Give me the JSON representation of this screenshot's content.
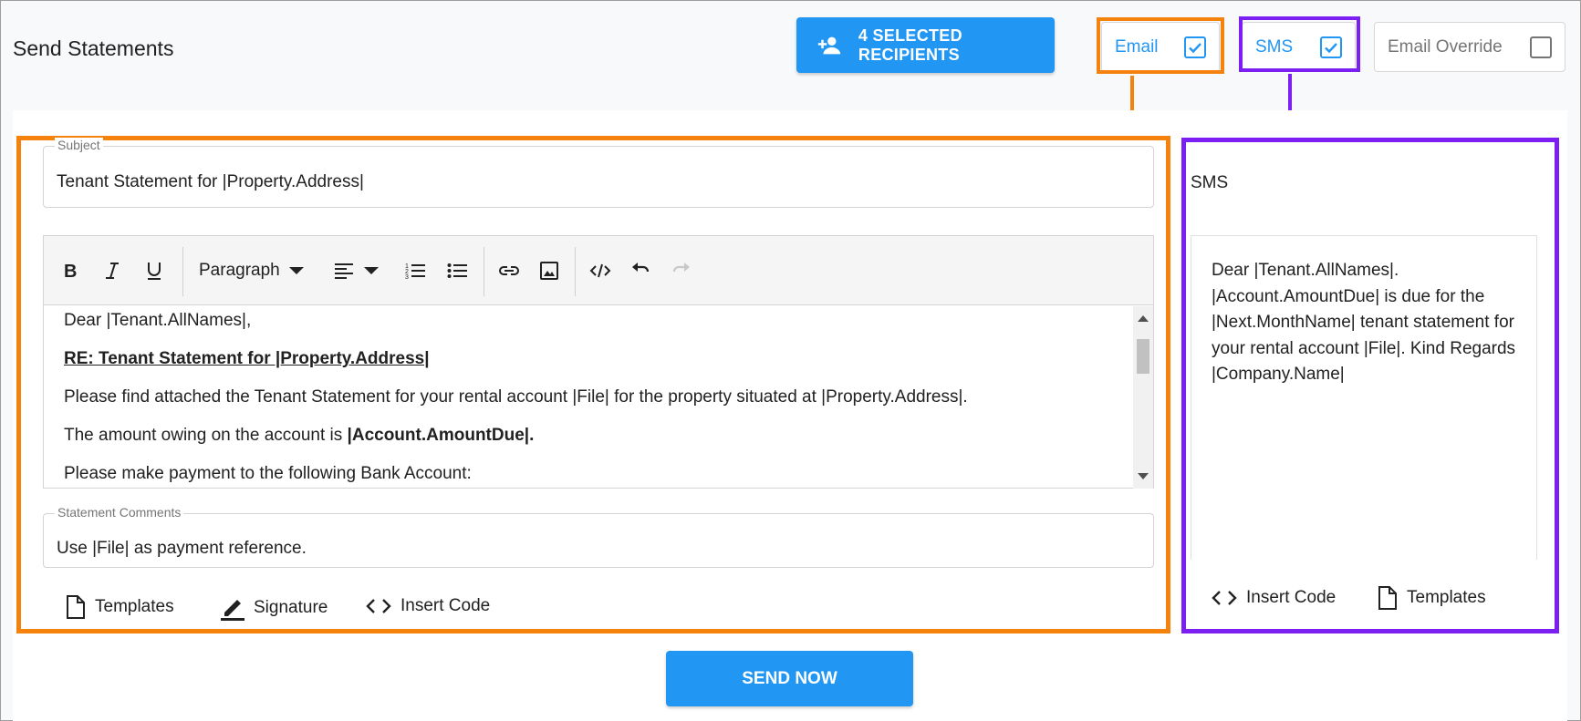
{
  "page": {
    "title": "Send Statements"
  },
  "header": {
    "recipients_label": "4 SELECTED RECIPIENTS",
    "toggles": {
      "email": {
        "label": "Email",
        "checked": true
      },
      "sms": {
        "label": "SMS",
        "checked": true
      },
      "email_override": {
        "label": "Email Override",
        "checked": false
      }
    }
  },
  "email": {
    "subject": {
      "label": "Subject",
      "value": "Tenant Statement for |Property.Address|"
    },
    "toolbar": {
      "paragraph_label": "Paragraph"
    },
    "body": {
      "greeting": "Dear |Tenant.AllNames|,",
      "re_line": "RE: Tenant Statement for |Property.Address|",
      "para1": "Please find attached the Tenant Statement for your rental account |File| for the property situated at |Property.Address|.",
      "para2_prefix": "The amount owing on the account is ",
      "para2_bold": "|Account.AmountDue|.",
      "para3": "Please make payment to the following Bank Account:"
    },
    "comments": {
      "label": "Statement Comments",
      "value": "Use |File| as payment reference."
    },
    "actions": {
      "templates": "Templates",
      "signature": "Signature",
      "insert_code": "Insert Code"
    }
  },
  "sms": {
    "title": "SMS",
    "message": "Dear |Tenant.AllNames|. |Account.AmountDue| is due for the |Next.MonthName| tenant statement for your rental account |File|. Kind Regards |Company.Name|",
    "actions": {
      "insert_code": "Insert Code",
      "templates": "Templates"
    }
  },
  "footer": {
    "send_label": "SEND NOW"
  },
  "colors": {
    "primary": "#2196f3",
    "highlight_email": "#f5820d",
    "highlight_sms": "#7b1ff2"
  }
}
